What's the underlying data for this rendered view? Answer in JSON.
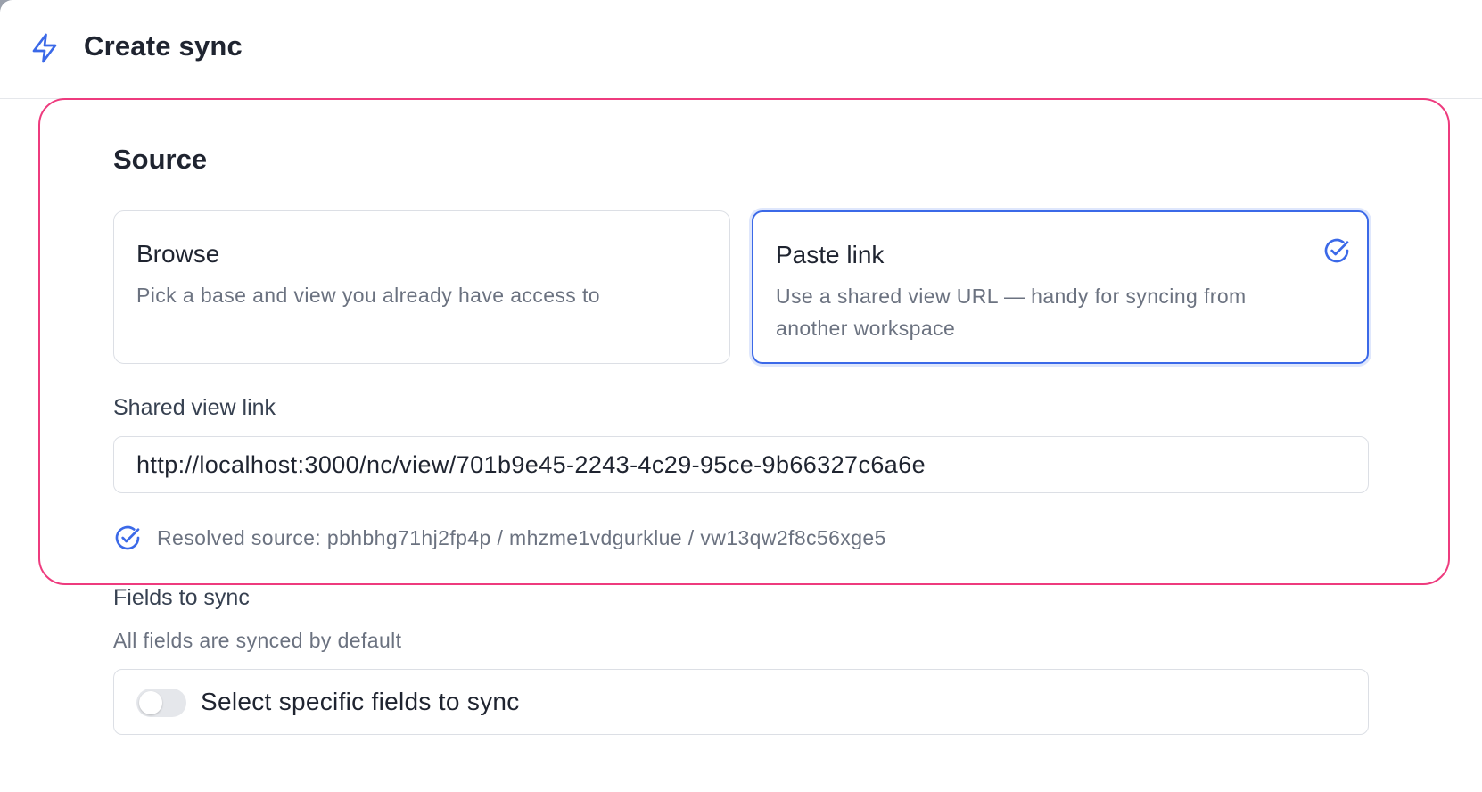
{
  "colors": {
    "accent": "#3b69e8",
    "highlight_border": "#ee3b7e",
    "muted_text": "#6b7280"
  },
  "header": {
    "icon": "lightning-bolt-icon",
    "title": "Create sync"
  },
  "source": {
    "title": "Source",
    "options": [
      {
        "title": "Browse",
        "description": "Pick a base and view you already have access to",
        "selected": false
      },
      {
        "title": "Paste link",
        "description": "Use a shared view URL — handy for syncing from another workspace",
        "selected": true,
        "icon": "check-circle-icon"
      }
    ],
    "link_label": "Shared view link",
    "link_value": "http://localhost:3000/nc/view/701b9e45-2243-4c29-95ce-9b66327c6a6e",
    "resolved_icon": "check-circle-icon",
    "resolved_text": "Resolved source: pbhbhg71hj2fp4p / mhzme1vdgurklue / vw13qw2f8c56xge5"
  },
  "fields": {
    "label": "Fields to sync",
    "help": "All fields are synced by default",
    "toggle_label": "Select specific fields to sync",
    "toggle_on": false
  }
}
